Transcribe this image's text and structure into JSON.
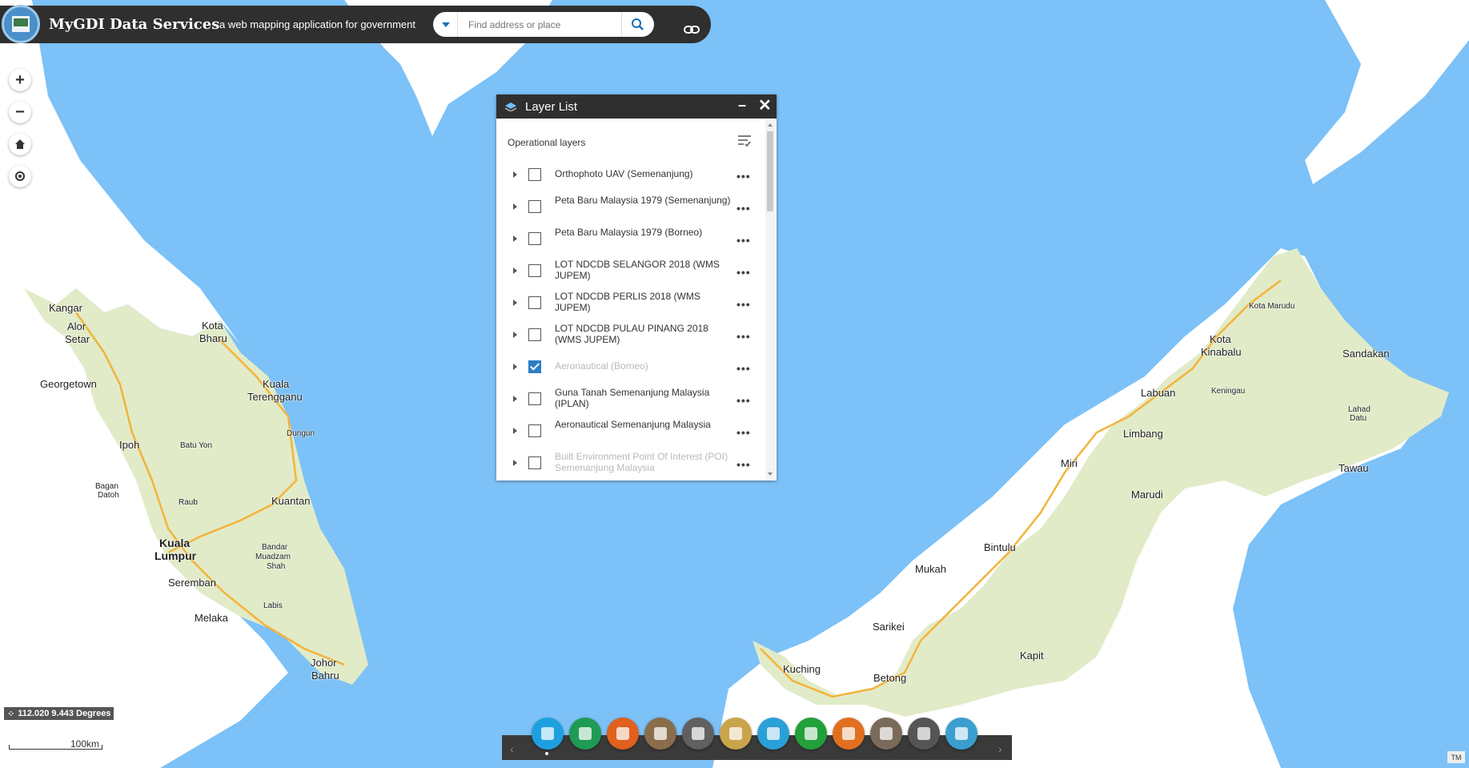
{
  "header": {
    "title": "MyGDI Data Services",
    "subtitle": "a web mapping application for government",
    "search_placeholder": "Find address or place"
  },
  "map_controls": {
    "zoom_in": "+",
    "zoom_out": "−"
  },
  "layer_list": {
    "title": "Layer List",
    "section_label": "Operational layers",
    "layers": [
      {
        "name": "Orthophoto UAV (Semenanjung)",
        "checked": false,
        "dimmed": false
      },
      {
        "name": "Peta Baru Malaysia 1979 (Semenanjung)",
        "checked": false,
        "dimmed": false
      },
      {
        "name": "Peta Baru Malaysia 1979 (Borneo)",
        "checked": false,
        "dimmed": false
      },
      {
        "name": "LOT NDCDB SELANGOR 2018 (WMS JUPEM)",
        "checked": false,
        "dimmed": false
      },
      {
        "name": "LOT NDCDB PERLIS 2018 (WMS JUPEM)",
        "checked": false,
        "dimmed": false
      },
      {
        "name": "LOT NDCDB PULAU PINANG 2018 (WMS JUPEM)",
        "checked": false,
        "dimmed": false
      },
      {
        "name": "Aeronautical (Borneo)",
        "checked": true,
        "dimmed": true
      },
      {
        "name": "Guna Tanah Semenanjung Malaysia (IPLAN)",
        "checked": false,
        "dimmed": false
      },
      {
        "name": "Aeronautical Semenanjung Malaysia",
        "checked": false,
        "dimmed": false
      },
      {
        "name": "Built Environment Point Of Interest (POI) Semenanjung Malaysia",
        "checked": false,
        "dimmed": true
      }
    ]
  },
  "coordinates": "112.020 9.443 Degrees",
  "scale": "100km",
  "attribution": "TM",
  "colors": {
    "water": "#7cc1f7",
    "land": "#e1ebc8",
    "highway": "#f4b33a",
    "header": "#2f2f30",
    "accent": "#2b7ec6"
  },
  "toolbar": {
    "widgets": [
      {
        "icon": "layer-list-icon",
        "color": "#1ea0e0"
      },
      {
        "icon": "basemap-gallery-icon",
        "color": "#1f9b55"
      },
      {
        "icon": "legend-icon",
        "color": "#e0601e"
      },
      {
        "icon": "add-data-icon",
        "color": "#8a6d4a"
      },
      {
        "icon": "locate-pin-icon",
        "color": "#606060"
      },
      {
        "icon": "measurement-icon",
        "color": "#c9a44a"
      },
      {
        "icon": "draw-icon",
        "color": "#2aa0d8"
      },
      {
        "icon": "bookmark-icon",
        "color": "#22a03a"
      },
      {
        "icon": "edit-icon",
        "color": "#e07020"
      },
      {
        "icon": "print-icon",
        "color": "#7a6a5a"
      },
      {
        "icon": "help-icon",
        "color": "#555555"
      },
      {
        "icon": "about-icon",
        "color": "#3a9fcf"
      }
    ]
  },
  "places": [
    {
      "name": "Kangar",
      "size": "med"
    },
    {
      "name": "Alor",
      "size": "med"
    },
    {
      "name": "Setar",
      "size": "med"
    },
    {
      "name": "Kota",
      "size": "med"
    },
    {
      "name": "Bharu",
      "size": "med"
    },
    {
      "name": "Georgetown",
      "size": "med"
    },
    {
      "name": "Kuala",
      "size": "med"
    },
    {
      "name": "Terengganu",
      "size": "med"
    },
    {
      "name": "Dungun",
      "size": "small"
    },
    {
      "name": "Ipoh",
      "size": "med"
    },
    {
      "name": "Batu Yon",
      "size": "small"
    },
    {
      "name": "Bagan",
      "size": "small"
    },
    {
      "name": "Datoh",
      "size": "small"
    },
    {
      "name": "Raub",
      "size": "small"
    },
    {
      "name": "Kuantan",
      "size": "med"
    },
    {
      "name": "Kuala",
      "size": "big"
    },
    {
      "name": "Lumpur",
      "size": "big"
    },
    {
      "name": "Bandar",
      "size": "small"
    },
    {
      "name": "Muadzam",
      "size": "small"
    },
    {
      "name": "Shah",
      "size": "small"
    },
    {
      "name": "Seremban",
      "size": "med"
    },
    {
      "name": "Labis",
      "size": "small"
    },
    {
      "name": "Melaka",
      "size": "med"
    },
    {
      "name": "Johor",
      "size": "med"
    },
    {
      "name": "Bahru",
      "size": "med"
    },
    {
      "name": "Kota Marudu",
      "size": "small"
    },
    {
      "name": "Kota",
      "size": "med"
    },
    {
      "name": "Kinabalu",
      "size": "med"
    },
    {
      "name": "Sandakan",
      "size": "med"
    },
    {
      "name": "Labuan",
      "size": "med"
    },
    {
      "name": "Keningau",
      "size": "small"
    },
    {
      "name": "Lahad",
      "size": "small"
    },
    {
      "name": "Datu",
      "size": "small"
    },
    {
      "name": "Limbang",
      "size": "med"
    },
    {
      "name": "Miri",
      "size": "med"
    },
    {
      "name": "Tawau",
      "size": "med"
    },
    {
      "name": "Marudi",
      "size": "med"
    },
    {
      "name": "Bintulu",
      "size": "med"
    },
    {
      "name": "Mukah",
      "size": "med"
    },
    {
      "name": "Sarikei",
      "size": "med"
    },
    {
      "name": "Kapit",
      "size": "med"
    },
    {
      "name": "Kuching",
      "size": "med"
    },
    {
      "name": "Betong",
      "size": "med"
    }
  ]
}
